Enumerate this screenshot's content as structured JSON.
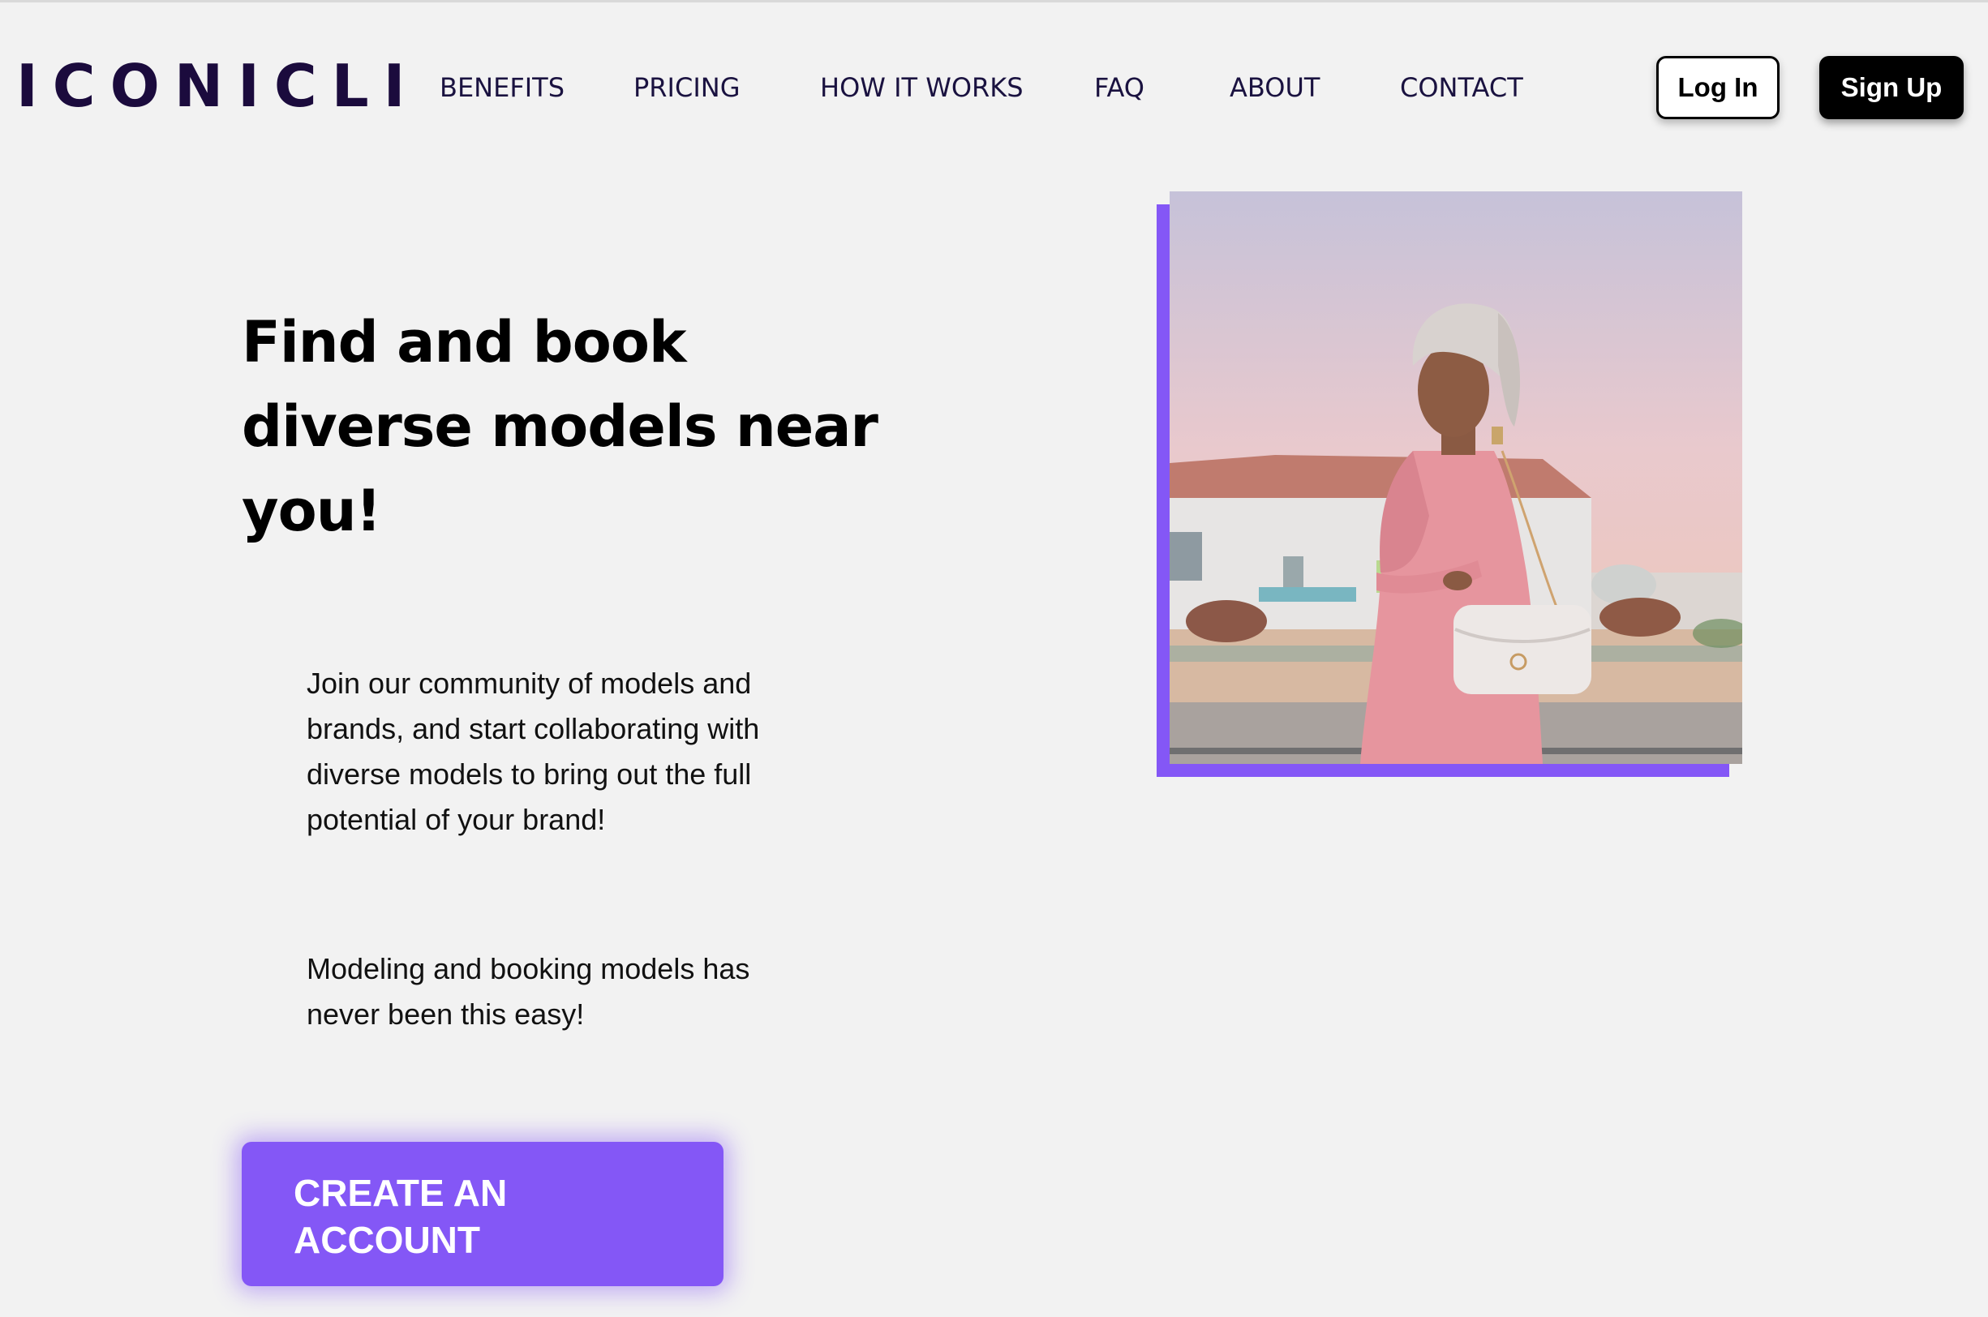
{
  "header": {
    "logo_text": "ICONICLI",
    "nav": [
      {
        "label": "BENEFITS"
      },
      {
        "label": "PRICING"
      },
      {
        "label": "HOW IT WORKS"
      },
      {
        "label": "FAQ"
      },
      {
        "label": "ABOUT"
      },
      {
        "label": "CONTACT"
      }
    ],
    "login_label": "Log In",
    "signup_label": "Sign Up"
  },
  "hero": {
    "title": "Find and book diverse models near you!",
    "paragraph_1": "Join our community of models and brands, and start collaborating with diverse models to bring out the full potential of your brand!",
    "paragraph_2": "Modeling and booking models has never been this easy!",
    "cta_label": "CREATE AN\nACCOUNT",
    "image_description_icon": "model-photo"
  },
  "colors": {
    "accent": "#8457f6",
    "logo": "#1b0b3d",
    "background": "#f2f2f2",
    "signup_bg": "#000000"
  }
}
